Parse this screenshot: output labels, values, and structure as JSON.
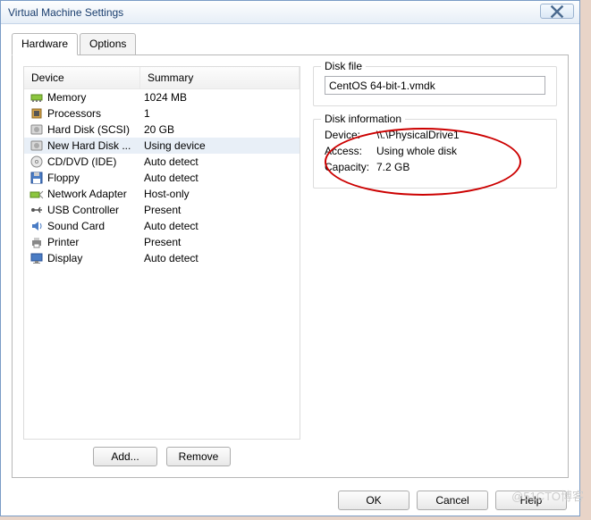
{
  "title": "Virtual Machine Settings",
  "tabs": {
    "hardware": "Hardware",
    "options": "Options"
  },
  "headers": {
    "device": "Device",
    "summary": "Summary"
  },
  "devices": [
    {
      "name": "Memory",
      "summary": "1024 MB",
      "icon": "memory"
    },
    {
      "name": "Processors",
      "summary": "1",
      "icon": "cpu"
    },
    {
      "name": "Hard Disk (SCSI)",
      "summary": "20 GB",
      "icon": "hdd"
    },
    {
      "name": "New Hard Disk ...",
      "summary": "Using device",
      "icon": "hdd",
      "selected": true
    },
    {
      "name": "CD/DVD (IDE)",
      "summary": "Auto detect",
      "icon": "cd"
    },
    {
      "name": "Floppy",
      "summary": "Auto detect",
      "icon": "floppy"
    },
    {
      "name": "Network Adapter",
      "summary": "Host-only",
      "icon": "net"
    },
    {
      "name": "USB Controller",
      "summary": "Present",
      "icon": "usb"
    },
    {
      "name": "Sound Card",
      "summary": "Auto detect",
      "icon": "sound"
    },
    {
      "name": "Printer",
      "summary": "Present",
      "icon": "printer"
    },
    {
      "name": "Display",
      "summary": "Auto detect",
      "icon": "display"
    }
  ],
  "buttons": {
    "add": "Add...",
    "remove": "Remove",
    "ok": "OK",
    "cancel": "Cancel",
    "help": "Help"
  },
  "diskfile": {
    "title": "Disk file",
    "value": "CentOS 64-bit-1.vmdk"
  },
  "diskinfo": {
    "title": "Disk information",
    "device_label": "Device:",
    "device_value": "\\\\.\\PhysicalDrive1",
    "access_label": "Access:",
    "access_value": "Using whole disk",
    "capacity_label": "Capacity:",
    "capacity_value": "7.2 GB"
  }
}
